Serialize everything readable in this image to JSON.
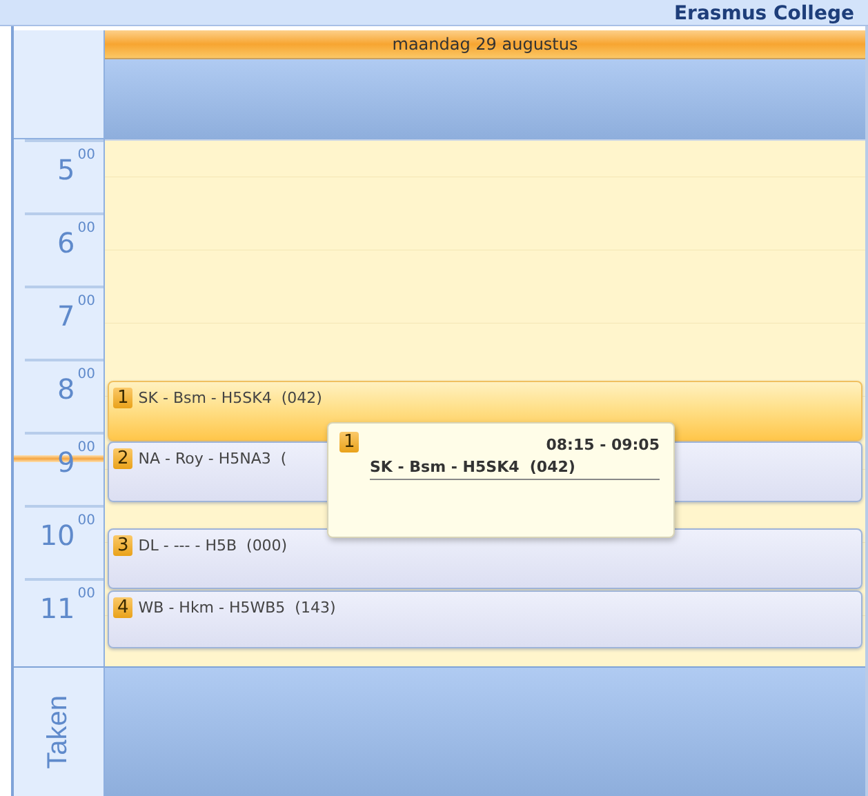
{
  "header": {
    "title": "Erasmus College"
  },
  "day": {
    "label": "maandag 29 augustus"
  },
  "hours": [
    {
      "hour": "5",
      "minutes": "00",
      "current": false
    },
    {
      "hour": "6",
      "minutes": "00",
      "current": false
    },
    {
      "hour": "7",
      "minutes": "00",
      "current": false
    },
    {
      "hour": "8",
      "minutes": "00",
      "current": false
    },
    {
      "hour": "9",
      "minutes": "00",
      "current": true
    },
    {
      "hour": "10",
      "minutes": "00",
      "current": false
    },
    {
      "hour": "11",
      "minutes": "00",
      "current": false
    }
  ],
  "events": [
    {
      "number": "1",
      "text": "SK - Bsm - H5SK4  (042)",
      "selected": true
    },
    {
      "number": "2",
      "text": "NA - Roy - H5NA3  (",
      "selected": false
    },
    {
      "number": "3",
      "text": "DL - --- - H5B  (000)",
      "selected": false
    },
    {
      "number": "4",
      "text": "WB - Hkm - H5WB5  (143)",
      "selected": false
    }
  ],
  "tooltip": {
    "number": "1",
    "time": "08:15 - 09:05",
    "text": "SK - Bsm - H5SK4  (042)"
  },
  "tasks": {
    "label": "Taken"
  }
}
